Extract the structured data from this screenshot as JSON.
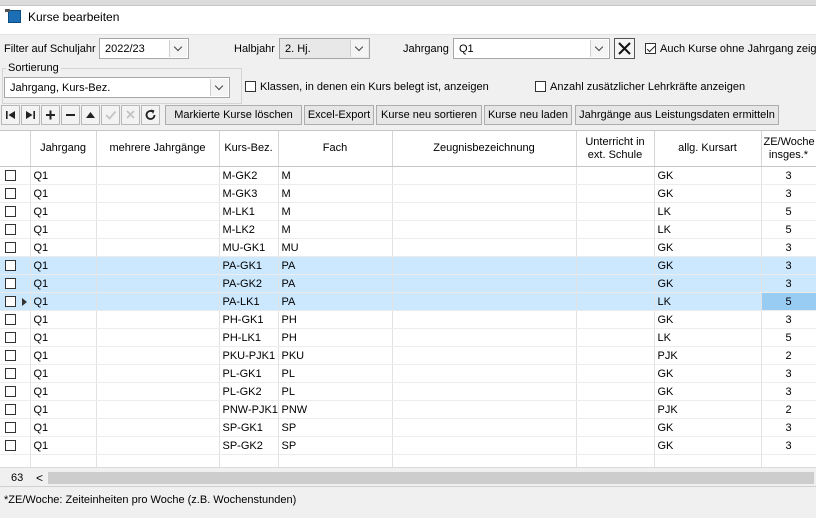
{
  "window": {
    "title": "Kurse bearbeiten"
  },
  "filters": {
    "schuljahr_label": "Filter auf Schuljahr",
    "schuljahr_value": "2022/23",
    "halbjahr_label": "Halbjahr",
    "halbjahr_value": "2. Hj.",
    "jahrgang_label": "Jahrgang",
    "jahrgang_value": "Q1",
    "auch_kurse_label": "Auch Kurse ohne Jahrgang zeige",
    "auch_kurse_checked": true
  },
  "sortierung": {
    "label": "Sortierung",
    "value": "Jahrgang, Kurs-Bez."
  },
  "options": {
    "klassen_label": "Klassen, in denen ein Kurs belegt ist, anzeigen",
    "anzahl_label": "Anzahl zusätzlicher Lehrkräfte anzeigen"
  },
  "toolbar": {
    "nav_icons": [
      "first-record-icon",
      "last-record-icon",
      "add-icon",
      "remove-icon",
      "move-up-icon",
      "confirm-icon",
      "cancel-icon",
      "refresh-icon"
    ],
    "delete_marked": "Markierte Kurse löschen",
    "excel_export": "Excel-Export",
    "resort": "Kurse neu sortieren",
    "reload": "Kurse neu laden",
    "jahrgaenge": "Jahrgänge aus Leistungsdaten ermitteln"
  },
  "table": {
    "columns": [
      "",
      "Jahrgang",
      "mehrere Jahrgänge",
      "Kurs-Bez.",
      "Fach",
      "Zeugnisbezeichnung",
      "Unterricht in ext. Schule",
      "allg. Kursart",
      "ZE/Woche insges.*"
    ],
    "rows": [
      {
        "jahrgang": "Q1",
        "mehrere": "",
        "kurs": "M-GK2",
        "fach": "M",
        "zeugnis": "",
        "ext": "",
        "kursart": "GK",
        "ze": "3"
      },
      {
        "jahrgang": "Q1",
        "mehrere": "",
        "kurs": "M-GK3",
        "fach": "M",
        "zeugnis": "",
        "ext": "",
        "kursart": "GK",
        "ze": "3"
      },
      {
        "jahrgang": "Q1",
        "mehrere": "",
        "kurs": "M-LK1",
        "fach": "M",
        "zeugnis": "",
        "ext": "",
        "kursart": "LK",
        "ze": "5"
      },
      {
        "jahrgang": "Q1",
        "mehrere": "",
        "kurs": "M-LK2",
        "fach": "M",
        "zeugnis": "",
        "ext": "",
        "kursart": "LK",
        "ze": "5"
      },
      {
        "jahrgang": "Q1",
        "mehrere": "",
        "kurs": "MU-GK1",
        "fach": "MU",
        "zeugnis": "",
        "ext": "",
        "kursart": "GK",
        "ze": "3"
      },
      {
        "jahrgang": "Q1",
        "mehrere": "",
        "kurs": "PA-GK1",
        "fach": "PA",
        "zeugnis": "",
        "ext": "",
        "kursart": "GK",
        "ze": "3",
        "selected": true
      },
      {
        "jahrgang": "Q1",
        "mehrere": "",
        "kurs": "PA-GK2",
        "fach": "PA",
        "zeugnis": "",
        "ext": "",
        "kursart": "GK",
        "ze": "3",
        "selected": true
      },
      {
        "jahrgang": "Q1",
        "mehrere": "",
        "kurs": "PA-LK1",
        "fach": "PA",
        "zeugnis": "",
        "ext": "",
        "kursart": "LK",
        "ze": "5",
        "selected": true,
        "current": true
      },
      {
        "jahrgang": "Q1",
        "mehrere": "",
        "kurs": "PH-GK1",
        "fach": "PH",
        "zeugnis": "",
        "ext": "",
        "kursart": "GK",
        "ze": "3"
      },
      {
        "jahrgang": "Q1",
        "mehrere": "",
        "kurs": "PH-LK1",
        "fach": "PH",
        "zeugnis": "",
        "ext": "",
        "kursart": "LK",
        "ze": "5"
      },
      {
        "jahrgang": "Q1",
        "mehrere": "",
        "kurs": "PKU-PJK1",
        "fach": "PKU",
        "zeugnis": "",
        "ext": "",
        "kursart": "PJK",
        "ze": "2"
      },
      {
        "jahrgang": "Q1",
        "mehrere": "",
        "kurs": "PL-GK1",
        "fach": "PL",
        "zeugnis": "",
        "ext": "",
        "kursart": "GK",
        "ze": "3"
      },
      {
        "jahrgang": "Q1",
        "mehrere": "",
        "kurs": "PL-GK2",
        "fach": "PL",
        "zeugnis": "",
        "ext": "",
        "kursart": "GK",
        "ze": "3"
      },
      {
        "jahrgang": "Q1",
        "mehrere": "",
        "kurs": "PNW-PJK1",
        "fach": "PNW",
        "zeugnis": "",
        "ext": "",
        "kursart": "PJK",
        "ze": "2"
      },
      {
        "jahrgang": "Q1",
        "mehrere": "",
        "kurs": "SP-GK1",
        "fach": "SP",
        "zeugnis": "",
        "ext": "",
        "kursart": "GK",
        "ze": "3"
      },
      {
        "jahrgang": "Q1",
        "mehrere": "",
        "kurs": "SP-GK2",
        "fach": "SP",
        "zeugnis": "",
        "ext": "",
        "kursart": "GK",
        "ze": "3"
      }
    ]
  },
  "footer": {
    "count": "63",
    "scroll_left_glyph": "<",
    "status_text": "*ZE/Woche: Zeiteinheiten pro Woche (z.B. Wochenstunden)"
  },
  "colors": {
    "selection": "#cce8ff",
    "current_cell": "#99ccf3",
    "window_icon": "#1c6fb5"
  }
}
